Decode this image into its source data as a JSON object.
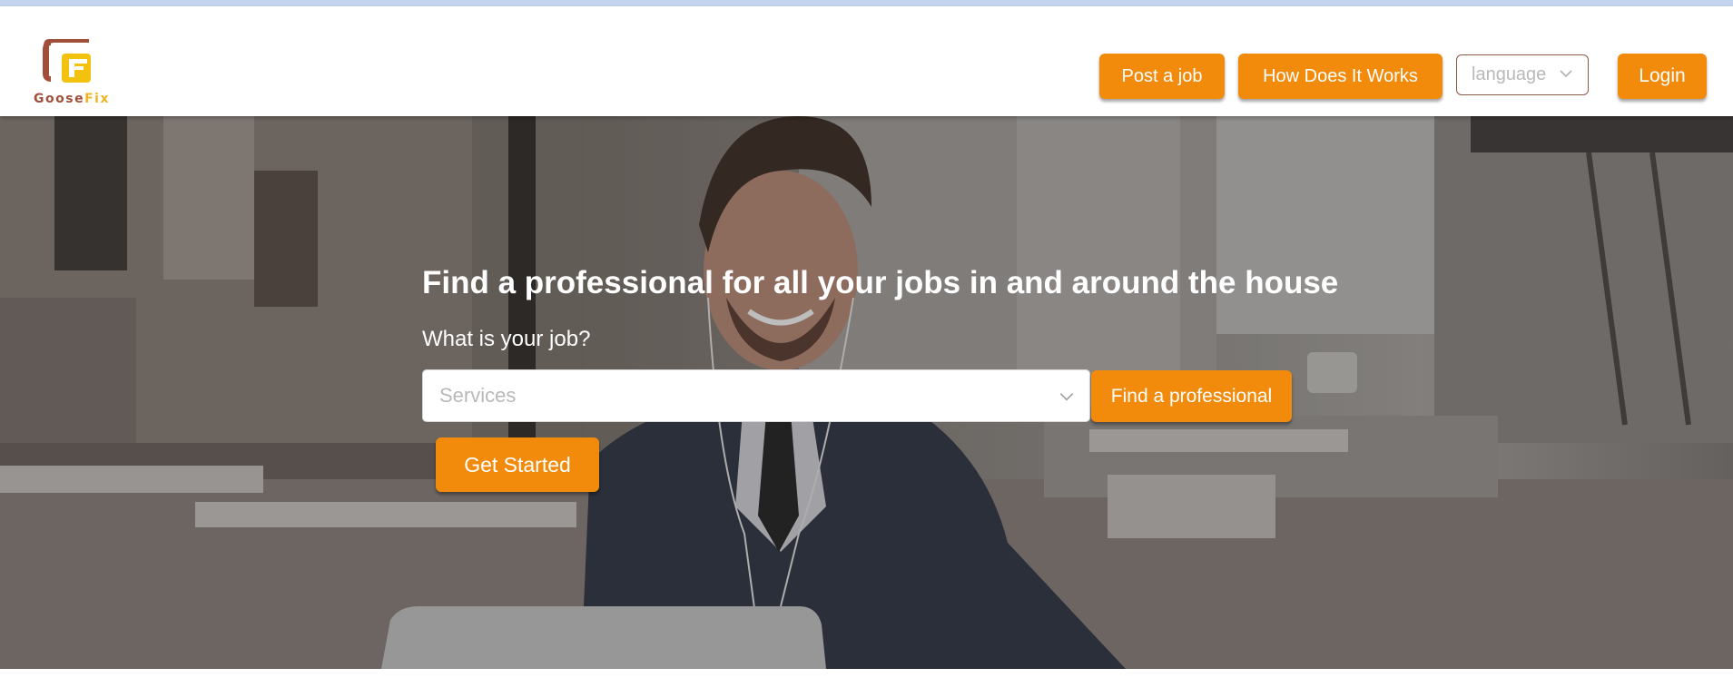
{
  "logo": {
    "word_part1": "Goose",
    "word_part2": "Fix",
    "icon": "goosefix-logo-icon"
  },
  "nav": {
    "post_job": "Post a job",
    "how_it_works": "How Does It Works",
    "language_placeholder": "language",
    "login": "Login"
  },
  "hero": {
    "headline": "Find a professional for all your jobs in and around the house",
    "question": "What is your job?",
    "services_placeholder": "Services",
    "find_button": "Find a professional",
    "get_started": "Get Started",
    "background": "photo-man-smiling-with-laptop"
  },
  "colors": {
    "accent": "#f28b0c",
    "logo_brown": "#a0503a",
    "logo_yellow": "#f2b320"
  }
}
